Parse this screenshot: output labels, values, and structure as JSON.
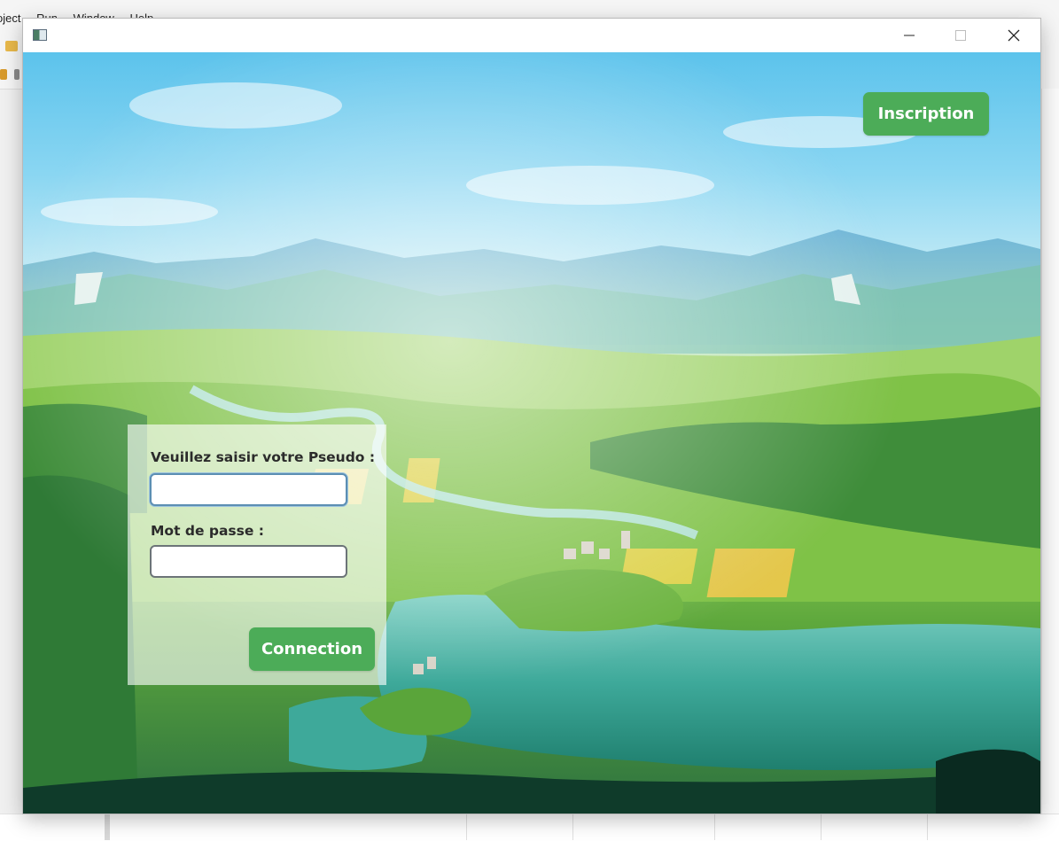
{
  "ide": {
    "menu": [
      "oject",
      "Run",
      "Window",
      "Help"
    ]
  },
  "window": {
    "title": "",
    "controls": {
      "minimize_icon": "minimize-icon",
      "maximize_icon": "maximize-icon",
      "close_icon": "close-icon"
    }
  },
  "scene": {
    "background": "landscape-illustration"
  },
  "header": {
    "signup_label": "Inscription"
  },
  "login": {
    "pseudo_label": "Veuillez saisir votre Pseudo :",
    "pseudo_value": "",
    "password_label": "Mot de passe :",
    "password_value": "",
    "connect_label": "Connection"
  },
  "colors": {
    "accent_green": "#4cac58",
    "panel": "rgba(255,255,255,0.62)",
    "focus_border": "#5c8fb3"
  }
}
